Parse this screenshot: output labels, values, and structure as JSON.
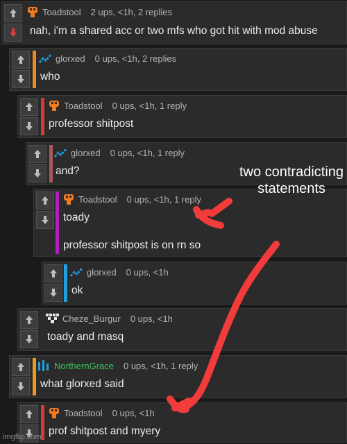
{
  "comments": [
    {
      "user": "Toadstool",
      "meta": "2 ups, <1h, 2 replies",
      "body": "nah, i'm a shared acc or two mfs who got hit with mod abuse",
      "icon": "mushroom-icon",
      "bar_color": "#ef7b22"
    },
    {
      "user": "glorxed",
      "meta": "0 ups, <1h, 2 replies",
      "body": "who",
      "icon": "trend-icon",
      "bar_color": "#ef8a1e"
    },
    {
      "user": "Toadstool",
      "meta": "0 ups, <1h, 1 reply",
      "body": "professor shitpost",
      "icon": "mushroom-icon",
      "bar_color": "#d23a3a"
    },
    {
      "user": "glorxed",
      "meta": "0 ups, <1h, 1 reply",
      "body": "and?",
      "icon": "trend-icon",
      "bar_color": "#a85a5a"
    },
    {
      "user": "Toadstool",
      "meta": "0 ups, <1h, 1 reply",
      "body": "toady",
      "body2": "professor shitpost is on rn so",
      "icon": "mushroom-icon",
      "bar_color": "#b01fc0"
    },
    {
      "user": "glorxed",
      "meta": "0 ups, <1h",
      "body": "ok",
      "icon": "trend-icon",
      "bar_color": "#1fa0e0"
    },
    {
      "user": "Cheze_Burgur",
      "meta": "0 ups, <1h",
      "body": "toady and masq",
      "icon": "pixel-icon",
      "bar_color": "#2b2b2b"
    },
    {
      "user": "NorthernGrace",
      "meta": "0 ups, <1h, 1 reply",
      "body": "what glorxed said",
      "icon": "bars-icon",
      "bar_color": "#ef9a1e",
      "user_color": "#3ec35a"
    },
    {
      "user": "Toadstool",
      "meta": "0 ups, <1h",
      "body": "prof shitpost and myery",
      "icon": "mushroom-icon",
      "bar_color": "#d23a3a"
    }
  ],
  "annotation": "two contradicting statements",
  "watermark": "imgflip.com",
  "colors": {
    "annotation_red": "#f23b3b",
    "upvote_active": "#e04040"
  }
}
